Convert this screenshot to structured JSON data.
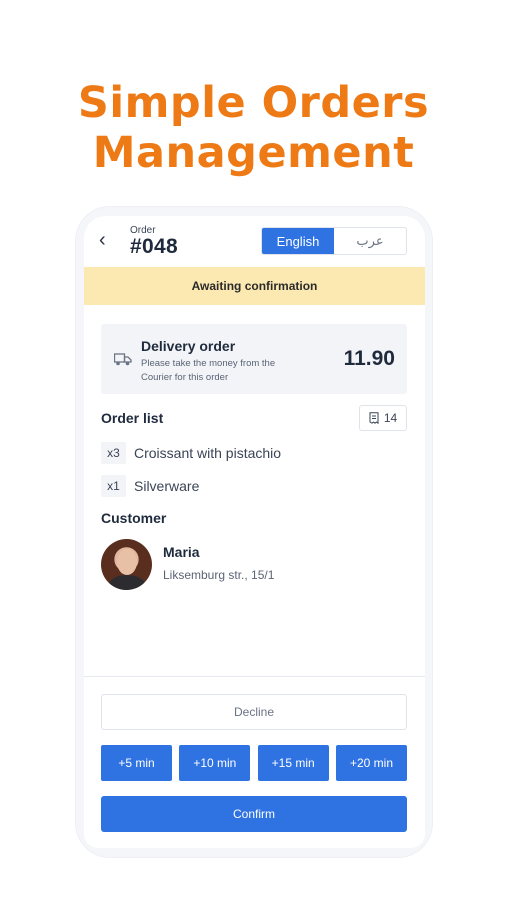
{
  "hero": {
    "line1": "Simple Orders",
    "line2": "Management"
  },
  "header": {
    "back_icon": "chevron-left-icon",
    "order_label": "Order",
    "order_number": "#048",
    "languages": [
      {
        "label": "English",
        "active": true
      },
      {
        "label": "عرب",
        "active": false
      }
    ]
  },
  "status": {
    "text": "Awaiting confirmation",
    "color": "#FCE9B2"
  },
  "delivery": {
    "icon": "delivery-truck-icon",
    "title": "Delivery order",
    "note": "Please take the money from the Courier for this order",
    "price": "11.90"
  },
  "order_list": {
    "title": "Order list",
    "badge_icon": "receipt-icon",
    "badge_count": "14",
    "items": [
      {
        "qty": "x3",
        "name": "Croissant with pistachio"
      },
      {
        "qty": "x1",
        "name": "Silverware"
      }
    ]
  },
  "customer": {
    "title": "Customer",
    "name": "Maria",
    "address": "Liksemburg str., 15/1"
  },
  "actions": {
    "decline": "Decline",
    "time_options": [
      "+5 min",
      "+10 min",
      "+15 min",
      "+20 min"
    ],
    "confirm": "Confirm"
  },
  "colors": {
    "accent": "#2F73E3",
    "hero": "#EE7A16",
    "status_bg": "#FCE9B2"
  }
}
